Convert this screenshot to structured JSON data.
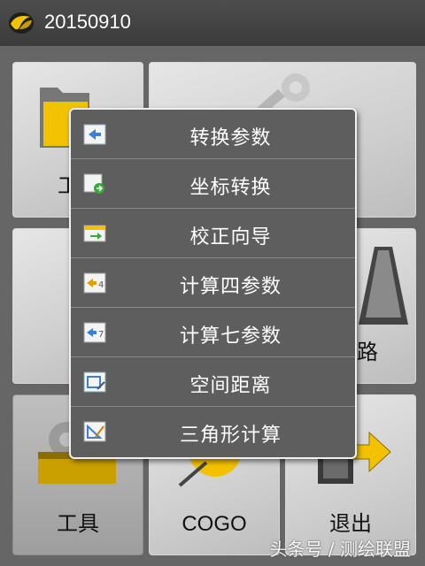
{
  "window": {
    "title": "20150910"
  },
  "tiles": {
    "tools": {
      "label": "工具"
    },
    "cogo": {
      "label": "COGO"
    },
    "exit": {
      "label": "退出"
    },
    "road": {
      "label_partial": "路"
    },
    "project_partial": {
      "label_partial": "工"
    }
  },
  "popup_menu": {
    "items": [
      {
        "label": "转换参数",
        "icon": "transform-params-icon"
      },
      {
        "label": "坐标转换",
        "icon": "coordinate-convert-icon"
      },
      {
        "label": "校正向导",
        "icon": "calibration-wizard-icon"
      },
      {
        "label": "计算四参数",
        "icon": "four-params-icon"
      },
      {
        "label": "计算七参数",
        "icon": "seven-params-icon"
      },
      {
        "label": "空间距离",
        "icon": "space-distance-icon"
      },
      {
        "label": "三角形计算",
        "icon": "triangle-calc-icon"
      }
    ]
  },
  "watermark": {
    "text": "头条号 / 测绘联盟"
  },
  "colors": {
    "titlebar": "#404040",
    "popup_bg": "#5e5e5e",
    "accent_yellow": "#f0c000"
  }
}
